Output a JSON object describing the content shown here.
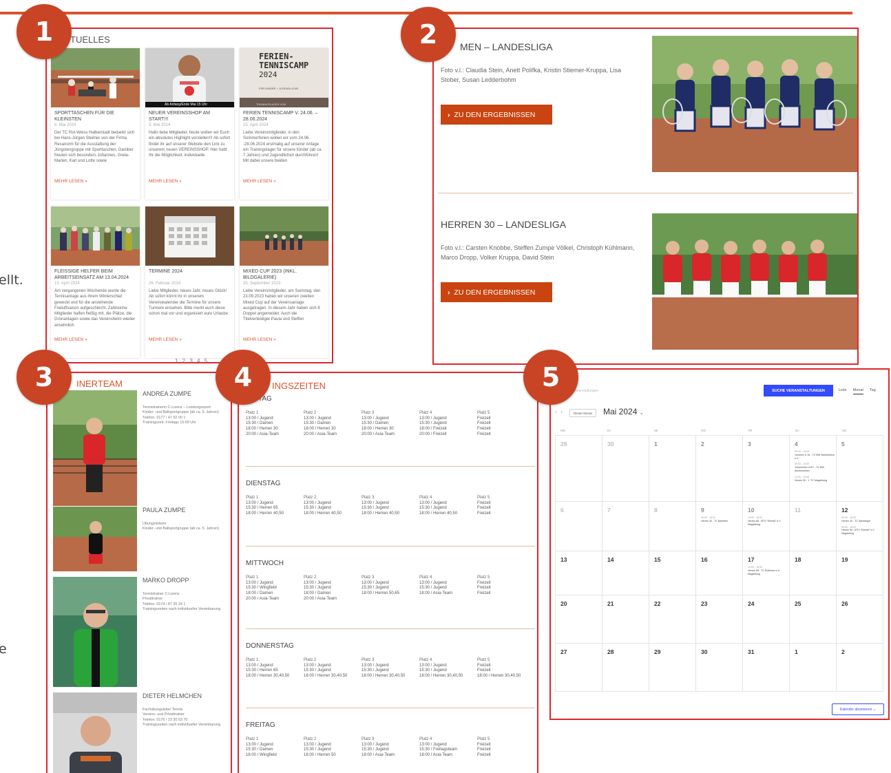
{
  "side_text": {
    "t1": "ellt.",
    "t2": "e"
  },
  "badges": [
    "1",
    "2",
    "3",
    "4",
    "5"
  ],
  "aktuelles": {
    "title": "TUELLES",
    "read_more": "MEHR LESEN »",
    "pages": "1 2 3 4 5",
    "items": [
      {
        "title": "SPORTTASCHEN FÜR DIE KLEINSTEN",
        "date": "8. Mai 2024",
        "text": "Der TC Rot-Weiss Halberstadt bedankt sich bei Hans-Jürgen Steimer von der Firma Recanorm für die Ausstattung der Jüngstengruppe mit Sporttaschen. Darüber freuten sich besonders Johannes, Greta-Marlen, Karl und Lotte sowie"
      },
      {
        "title": "NEUER VEREINSSHOP AM START!!!",
        "date": "3. Mai 2024",
        "text": "Hallo liebe Mitglieder, heute wollen wir Euch ein absolutes Highlight vorstellen!!! Ab sofort findet ihr auf unserer Website den Link zu unserem neuen VEREINSSHOP. Hier habt Ihr die Möglichkeit, individuelle"
      },
      {
        "title": "FERIEN TENNISCAMP V. 24.06. – 28.06.2024",
        "date": "15. April 2024",
        "text": "Liebe Vereinsmitglieder, in den Sommerferien wollen wir vom 24.06. -28.06.2024 erstmalig auf unserer Anlage ein Trainingslager für unsere Kinder (ab ca. 7 Jahren) und Jugendlichen durchführen! Mit dabei unsere beiden"
      },
      {
        "title": "FLEISSIGE HELFER BEIM ARBEITSEINSATZ AM 13.04.2024",
        "date": "15. April 2024",
        "text": "Am vergangenen Wochende wurde die Tennisanlage aus ihrem Winterschlaf geweckt und für die anstehende Freiluftsaison aufgeschlecht. Zahlreiche Mitglieder halfen fleißig mit, die Plätze, die Grünanlagen sowie das Vereinsheim wieder ansehnlich"
      },
      {
        "title": "TERMINE 2024",
        "date": "26. Februar 2024",
        "text": "Liebe Mitglieder, neues Jahr, neues Glück! Ab sofort könnt ihr in unserem Vereinskalender die Termine für unsere Turniere einsehen. Bitte merkt euch diese schon mal vor und organisiert eure Urlaube"
      },
      {
        "title": "MIXED CUP 2023 (INKL. BILDGALERIE)",
        "date": "25. September 2023",
        "text": "Liebe Vereinsmitglieder, am Samstag, den 23.09.2023 haben wir unseren zweiten Mixed Cup auf der Vereinsanlage ausgetragen. In diesem Jahr haben sich 8 Doppel angemeldet. Auch die Titelverteidiger Paula und Steffen"
      }
    ],
    "camp_poster": {
      "line1": "FERIEN-",
      "line2": "TENNISCAMP",
      "year": "2024",
      "sub": "FÜR KINDER + JUGENDLICHE",
      "foot": "TRAININGSLAGER VOM"
    },
    "shop_banner": "Ab Anfang/Ende Mai 15 Uhr"
  },
  "mannschaften": [
    {
      "title": "MEN – LANDESLIGA",
      "caption": "Foto v.l.: Claudia Stein, Anett Polifka, Kristin Stiemer-Kruppa, Lisa Stober, Susan Ledderbohm",
      "button": "ZU DEN ERGEBNISSEN"
    },
    {
      "title": "HERREN 30 – LANDESLIGA",
      "caption": "Foto v.l.: Carsten Knobbe, Steffen Zumpe Völkel,  Christoph Kühlmann, Marco Dropp, Volker Kruppa, David Stein",
      "button": "ZU DEN ERGEBNISSEN"
    }
  ],
  "trainer": {
    "title": "INERTEAM",
    "people": [
      {
        "name": "ANDREA ZUMPE",
        "desc": "Tennistrainerin C-Lizenz – Leistungssport\nKinder- und Ballsportgruppe (ab ca. 5. Jahren)\nTelefon: 0177 / 47 92 00 1\nTrainingszeit: Freitags 15:00 Uhr"
      },
      {
        "name": "PAULA ZUMPE",
        "desc": "Übungsleiterin\nKinder- und Ballsportgruppe (ab ca. 5. Jahren)"
      },
      {
        "name": "MARKO DROPP",
        "desc": "Tennistrainer C-Lizenz\nPrivattrainer\nTelefon: 0174 / 87 35 24 1\nTrainingszeiten nach individueller Vereinbarung"
      },
      {
        "name": "DIETER HELMCHEN",
        "desc": "Fachübungsleiter Tennis\nVereins- und Privattrainer\nTelefon: 0176 / 23 30 03 70\nTrainingszeiten nach individueller Vereinbarung"
      }
    ]
  },
  "trainingszeiten": {
    "title": "INGSZEITEN",
    "days": [
      {
        "name": "TAG",
        "cols": [
          {
            "h": "Platz 1",
            "rows": [
              "13:00 / Jugend",
              "15:30 / Damen",
              "18:00 / Herren 30",
              "20:00 / Asia-Team"
            ]
          },
          {
            "h": "Platz 2",
            "rows": [
              "13:00 / Jugend",
              "15:30 / Damen",
              "18:00 / Herren 30",
              "20:00 / Asia-Team"
            ]
          },
          {
            "h": "Platz 3",
            "rows": [
              "13:00 / Jugend",
              "15:30 / Damen",
              "18:00 / Herren 30",
              "20:00 / Asia-Team"
            ]
          },
          {
            "h": "Platz 4",
            "rows": [
              "13:00 / Jugend",
              "15:30 / Jugend",
              "18:00 / Freizeit",
              "20:00 / Freizeit"
            ]
          },
          {
            "h": "Platz 5",
            "rows": [
              "Freizeit",
              "Freizeit",
              "Freizeit",
              "Freizeit"
            ]
          }
        ]
      },
      {
        "name": "DIENSTAG",
        "cols": [
          {
            "h": "Platz 1",
            "rows": [
              "13:00 / Jugend",
              "15:30 / Herren 65",
              "18:00 / Herren 40,50"
            ]
          },
          {
            "h": "Platz 2",
            "rows": [
              "13:00 / Jugend",
              "15:30 / Jugend",
              "18:00 / Herren 40,50"
            ]
          },
          {
            "h": "Platz 3",
            "rows": [
              "13:00 / Jugend",
              "15:30 / Jugend",
              "18:00 / Herren 40,50"
            ]
          },
          {
            "h": "Platz 4",
            "rows": [
              "13:00 / Jugend",
              "15:30 / Jugend",
              "18:00 / Herren 40,50"
            ]
          },
          {
            "h": "Platz 5",
            "rows": [
              "Freizeit",
              "Freizeit",
              "Freizeit"
            ]
          }
        ]
      },
      {
        "name": "MITTWOCH",
        "cols": [
          {
            "h": "Platz 1",
            "rows": [
              "13:00 / Jugend",
              "15:30 / Wingfield",
              "18:00 / Damen",
              "20:00 / Asia-Team"
            ]
          },
          {
            "h": "Platz 2",
            "rows": [
              "13:00 / Jugend",
              "15:30 / Jugend",
              "18:00 / Damen",
              "20:00 / Asia-Team"
            ]
          },
          {
            "h": "Platz 3",
            "rows": [
              "13:00 / Jugend",
              "15:30 / Jugend",
              "18:00 / Herren 50,65"
            ]
          },
          {
            "h": "Platz 4",
            "rows": [
              "13:00 / Jugend",
              "15:30 / Jugend",
              "18:00 / Asia-Team"
            ]
          },
          {
            "h": "Platz 5",
            "rows": [
              "Freizeit",
              "Freizeit",
              "Freizeit"
            ]
          }
        ]
      },
      {
        "name": "DONNERSTAG",
        "cols": [
          {
            "h": "Platz 1",
            "rows": [
              "13:00 / Jugend",
              "15:30 / Herren 65",
              "18:00 / Herren 30,40,50"
            ]
          },
          {
            "h": "Platz 2",
            "rows": [
              "13:00 / Jugend",
              "15:30 / Jugend",
              "18:00 / Herren 30,40,50"
            ]
          },
          {
            "h": "Platz 3",
            "rows": [
              "13:00 / Jugend",
              "15:30 / Jugend",
              "18:00 / Herren 30,40,50"
            ]
          },
          {
            "h": "Platz 4",
            "rows": [
              "13:00 / Jugend",
              "15:30 / Jugend",
              "18:00 / Herren 30,40,50"
            ]
          },
          {
            "h": "Platz 5",
            "rows": [
              "Freizeit",
              "Freizeit",
              "18:00 / Herren 30,40,50"
            ]
          }
        ]
      },
      {
        "name": "FREITAG",
        "cols": [
          {
            "h": "Platz 1",
            "rows": [
              "13:00 / Jugend",
              "15:30 / Damen",
              "18:00 / Wingfield"
            ]
          },
          {
            "h": "Platz 2",
            "rows": [
              "13:00 / Jugend",
              "15:30 / Jugend",
              "18:00 / Herren 50"
            ]
          },
          {
            "h": "Platz 3",
            "rows": [
              "13:00 / Jugend",
              "15:30 / Jugend",
              "18:00 / Asia-Team"
            ]
          },
          {
            "h": "Platz 4",
            "rows": [
              "13:00 / Jugend",
              "15:30 / Freitagsteam",
              "18:00 / Asia-Team"
            ]
          },
          {
            "h": "Platz 5",
            "rows": [
              "Freizeit",
              "Freizeit",
              "Freizeit"
            ]
          }
        ]
      }
    ]
  },
  "kalender": {
    "search_placeholder": "Nach Veranstaltungen",
    "search_button": "SUCHE VERANSTALTUNGEN",
    "views": [
      "Liste",
      "Monat",
      "Tag"
    ],
    "today": "Dieser Monat",
    "month": "Mai 2024",
    "weekdays": [
      "MO",
      "DI",
      "MI",
      "DO",
      "FR",
      "SA",
      "SO"
    ],
    "subscribe": "Kalender abonnieren",
    "cells": [
      {
        "d": "29",
        "m": true
      },
      {
        "d": "30",
        "m": true
      },
      {
        "d": "1"
      },
      {
        "d": "2"
      },
      {
        "d": "3"
      },
      {
        "d": "4",
        "ev": [
          {
            "t": "09:00 - 14:00",
            "n": "Junioren U 18 - TC BW Schönebeck e.V."
          },
          {
            "t": "09:00 - 14:00",
            "n": "Juniorinnen U15 I - TC BW Aschersleben"
          },
          {
            "t": "14:00 - 19:00",
            "n": "Herren 30 - 1. TC Magdeburg"
          }
        ]
      },
      {
        "d": "5"
      },
      {
        "d": "6",
        "m": true
      },
      {
        "d": "7",
        "m": true
      },
      {
        "d": "8",
        "m": true
      },
      {
        "d": "9",
        "ev": [
          {
            "t": "09:00 - 16:00",
            "n": "Herren 40 - TV Barleben"
          }
        ]
      },
      {
        "d": "10",
        "ev": [
          {
            "t": "10:00 - 16:00",
            "n": "Herren 65 - MTV \"Einheit\" e.V. Magdeburg"
          }
        ]
      },
      {
        "d": "11",
        "m": true
      },
      {
        "d": "12",
        "s": true,
        "ev": [
          {
            "t": "09:00 - 16:00",
            "n": "Herren 40 - TC Sandanger"
          },
          {
            "t": "09:00 - 16:00",
            "n": "Herren 50 - MTV \"Einheit\" e.V. Magdeburg"
          }
        ]
      },
      {
        "d": "13",
        "s": true
      },
      {
        "d": "14",
        "s": true
      },
      {
        "d": "15",
        "s": true
      },
      {
        "d": "16",
        "s": true
      },
      {
        "d": "17",
        "s": true,
        "ev": [
          {
            "t": "10:00 - 16:00",
            "n": "Herren 65 - TC Rotehorn e.V. Magdeburg"
          }
        ]
      },
      {
        "d": "18",
        "s": true
      },
      {
        "d": "19",
        "s": true
      },
      {
        "d": "20",
        "s": true
      },
      {
        "d": "21",
        "s": true
      },
      {
        "d": "22",
        "s": true
      },
      {
        "d": "23",
        "s": true
      },
      {
        "d": "24",
        "s": true
      },
      {
        "d": "25",
        "s": true
      },
      {
        "d": "26",
        "s": true
      },
      {
        "d": "27",
        "s": true
      },
      {
        "d": "28",
        "s": true
      },
      {
        "d": "29",
        "s": true
      },
      {
        "d": "30",
        "s": true
      },
      {
        "d": "31",
        "s": true
      },
      {
        "d": "1",
        "s": true
      },
      {
        "d": "2",
        "s": true
      }
    ]
  },
  "colors": {
    "accent": "#d9532c",
    "panel_border": "#e0262b",
    "button": "#c94410",
    "cal_blue": "#334aff"
  }
}
